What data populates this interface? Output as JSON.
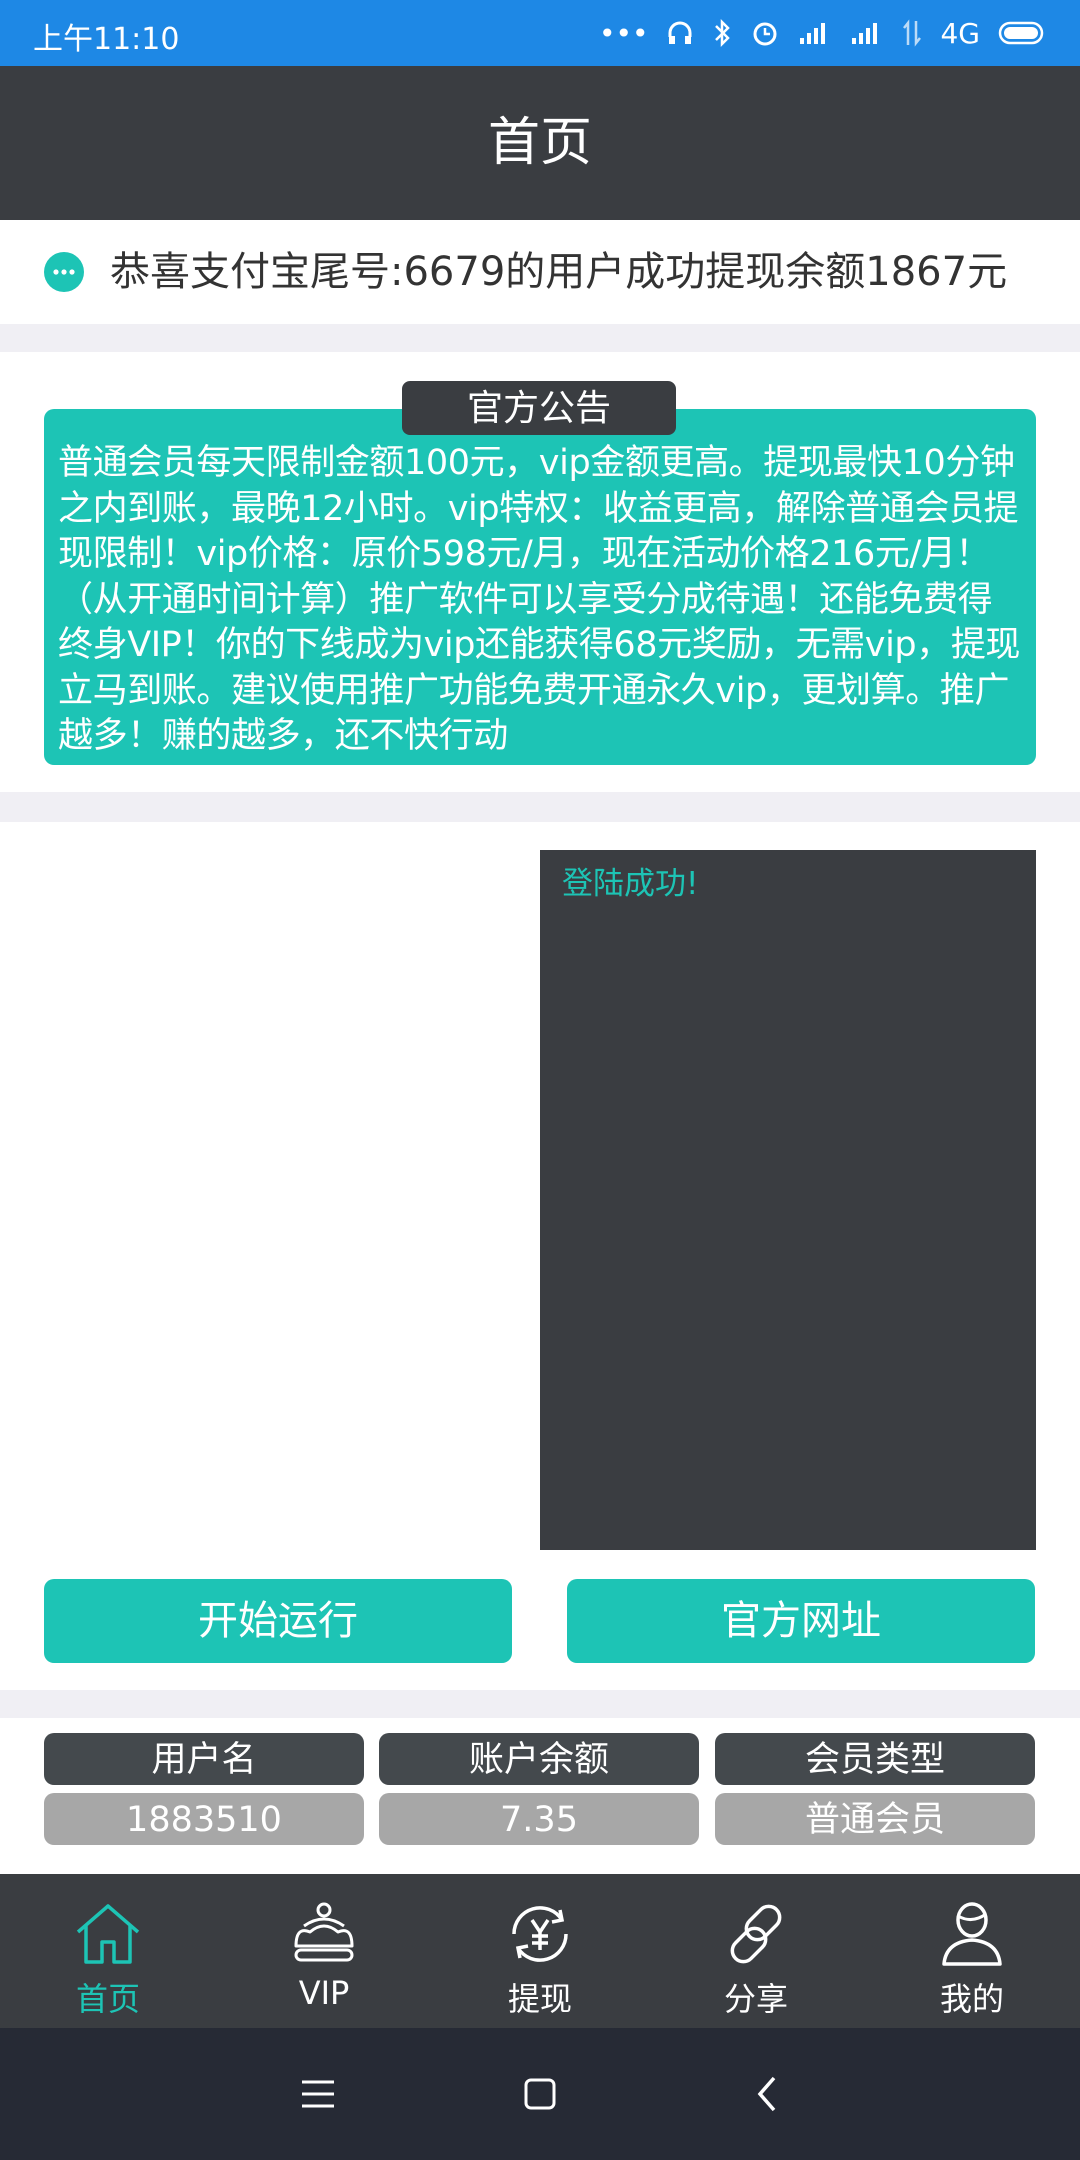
{
  "status_bar": {
    "time": "上午11:10",
    "network": "4G"
  },
  "header": {
    "title": "首页"
  },
  "ticker": {
    "icon": "chat-bubble-icon",
    "message": "恭喜支付宝尾号:6679的用户成功提现余额1867元"
  },
  "announcement": {
    "tag": "官方公告",
    "text": "普通会员每天限制金额100元，vip金额更高。提现最快10分钟之内到账，最晚12小时。vip特权：收益更高，解除普通会员提现限制！vip价格：原价598元/月，现在活动价格216元/月！（从开通时间计算）推广软件可以享受分成待遇！还能免费得终身VIP！你的下线成为vip还能获得68元奖励，无需vip，提现立马到账。建议使用推广功能免费开通永久vip，更划算。推广越多！赚的越多，还不快行动"
  },
  "log": {
    "line": "登陆成功!"
  },
  "actions": {
    "start": "开始运行",
    "site": "官方网址"
  },
  "user_info": {
    "headers": [
      "用户名",
      "账户余额",
      "会员类型"
    ],
    "values": [
      "1883510",
      "7.35",
      "普通会员"
    ]
  },
  "tabs": [
    {
      "label": "首页",
      "icon": "home-icon",
      "active": true
    },
    {
      "label": "VIP",
      "icon": "crown-icon",
      "active": false
    },
    {
      "label": "提现",
      "icon": "withdraw-yen-icon",
      "active": false
    },
    {
      "label": "分享",
      "icon": "link-icon",
      "active": false
    },
    {
      "label": "我的",
      "icon": "user-icon",
      "active": false
    }
  ],
  "colors": {
    "accent": "#1dc4b5",
    "dark": "#3a3d41",
    "status_bar": "#1e88e5"
  }
}
